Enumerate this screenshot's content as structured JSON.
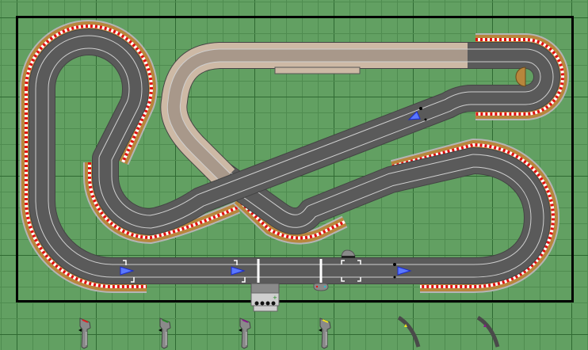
{
  "colors": {
    "background": "#62a062",
    "grid_minor": "#4f8c50",
    "grid_major": "#2f6a32",
    "border": "#000000",
    "road": "#5a5a5a",
    "lane_line": "#cfcfcf",
    "bridge": "#cdb9a5",
    "curb_tan": "#b8863c",
    "curb_edge": "#b4b4b4",
    "curb_red": "#e01010",
    "marker": "#5a78ff"
  },
  "controllers": [
    {
      "name": "controller-red",
      "color": "#e02020"
    },
    {
      "name": "controller-green",
      "color": "#2a8a2a"
    },
    {
      "name": "controller-purple",
      "color": "#8a1a8a"
    },
    {
      "name": "controller-yellow",
      "color": "#f0e020"
    }
  ],
  "lap_sensors": [
    {
      "name": "lane-sensor-yellow",
      "color": "#f0e020"
    },
    {
      "name": "lane-sensor-purple",
      "color": "#8a1a8a"
    }
  ]
}
